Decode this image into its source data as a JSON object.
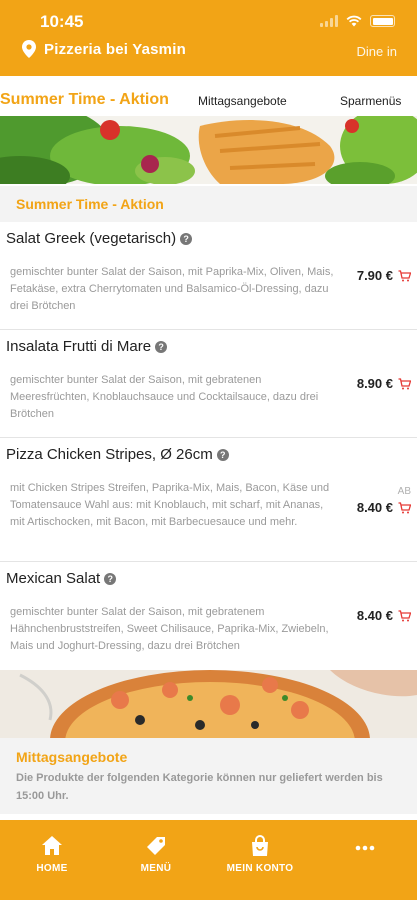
{
  "status_bar": {
    "time": "10:45"
  },
  "header": {
    "restaurant_name": "Pizzeria bei Yasmin",
    "mode_label": "Dine in"
  },
  "tabs": [
    {
      "label": "Summer Time - Aktion"
    },
    {
      "label": "Mittagsangebote"
    },
    {
      "label": "Sparmenüs"
    }
  ],
  "section": {
    "title": "Summer Time - Aktion"
  },
  "items": [
    {
      "name": "Salat Greek (vegetarisch)",
      "description": "gemischter bunter Salat der Saison, mit Paprika-Mix, Oliven, Mais, Fetakäse, extra Cherrytomaten und Balsamico-Öl-Dressing, dazu drei Brötchen",
      "price": "7.90 €",
      "allergen": ""
    },
    {
      "name": "Insalata Frutti di Mare",
      "description": "gemischter bunter Salat der Saison, mit gebratenen Meeresfrüchten, Knoblauchsauce und Cocktailsauce, dazu drei Brötchen",
      "price": "8.90 €",
      "allergen": ""
    },
    {
      "name": "Pizza Chicken Stripes, Ø 26cm",
      "description": "mit Chicken Stripes Streifen, Paprika-Mix, Mais, Bacon, Käse und Tomatensauce Wahl aus: mit Knoblauch, mit scharf, mit Ananas, mit Artischocken, mit Bacon, mit Barbecuesauce und mehr.",
      "price": "8.40 €",
      "allergen": "AB"
    },
    {
      "name": "Mexican Salat",
      "description": "gemischter bunter Salat der Saison, mit gebratenem Hähnchenbruststreifen, Sweet Chilisauce, Paprika-Mix, Zwiebeln, Mais und Joghurt-Dressing, dazu drei Brötchen",
      "price": "8.40 €",
      "allergen": ""
    }
  ],
  "next_section": {
    "title": "Mittagsangebote",
    "notice": "Die Produkte der folgenden Kategorie können nur geliefert werden bis 15:00 Uhr."
  },
  "bottom_nav": [
    {
      "label": "HOME",
      "icon": "home-icon"
    },
    {
      "label": "MENÜ",
      "icon": "tag-icon"
    },
    {
      "label": "MEIN KONTO",
      "icon": "shopping-bag-icon"
    },
    {
      "label": "",
      "icon": "more-dots-icon"
    }
  ],
  "colors": {
    "accent": "#f2a416",
    "cart": "#e53935",
    "muted_text": "#9a9a9a",
    "section_bg": "#f3f3f3"
  },
  "help_icon_glyph": "?"
}
